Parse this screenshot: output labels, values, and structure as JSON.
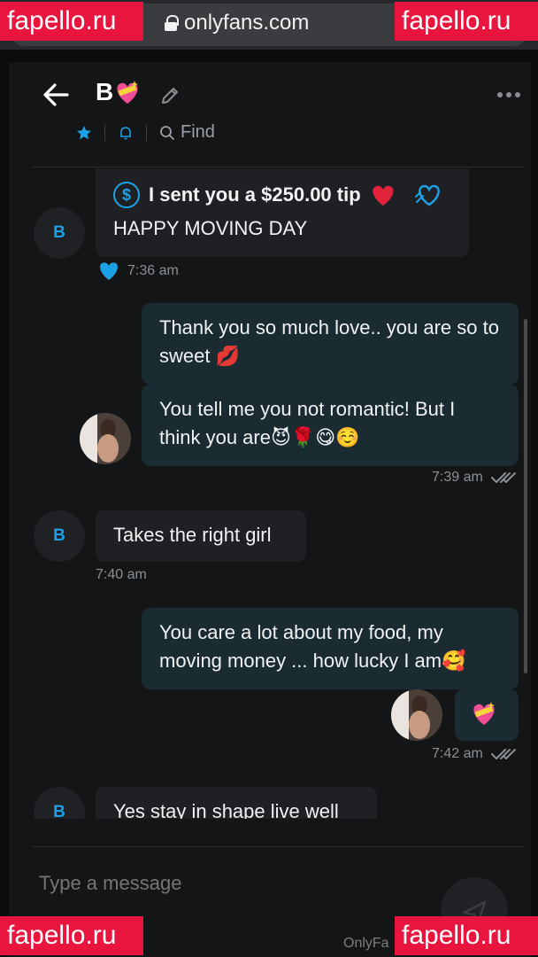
{
  "browser": {
    "url": "onlyfans.com"
  },
  "watermark": {
    "text": "fapello.ru"
  },
  "header": {
    "contact_name": "B",
    "find_label": "Find"
  },
  "messages": {
    "tip": {
      "text": "I sent you a $250.00 tip",
      "body": "HAPPY MOVING DAY",
      "time": "7:36 am",
      "avatar_letter": "B"
    },
    "out1": {
      "text": "Thank you so much love.. you are so to sweet 💋"
    },
    "out2": {
      "text": "You tell me you not romantic! But I think you are😈🌹😋☺️",
      "time": "7:39 am"
    },
    "in2": {
      "text": "Takes the right girl",
      "time": "7:40 am",
      "avatar_letter": "B"
    },
    "out3": {
      "text": "You care a lot about my food, my moving money ... how lucky I am🥰",
      "time": "7:42 am"
    },
    "in3": {
      "text": "Yes stay in shape live well",
      "avatar_letter": "B"
    }
  },
  "composer": {
    "placeholder": "Type a message"
  },
  "footer": {
    "text": "OnlyFa"
  },
  "colors": {
    "accent": "#1da1e6",
    "watermark": "#e8153f",
    "outgoing_bubble": "#1a2b31",
    "incoming_bubble": "#1e2023"
  }
}
